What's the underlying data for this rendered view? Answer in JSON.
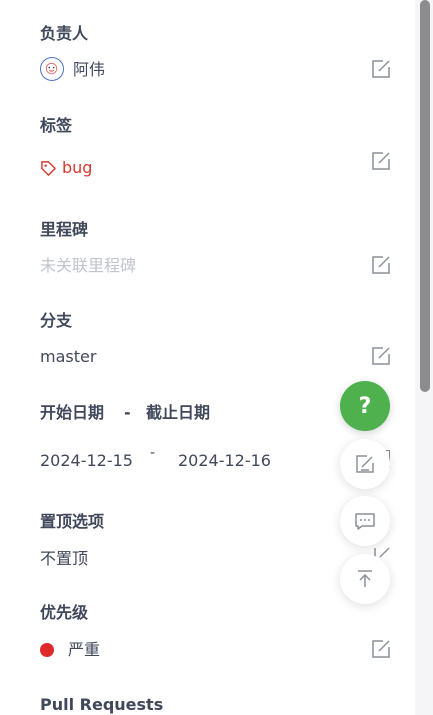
{
  "assignee": {
    "label": "负责人",
    "value": "阿伟"
  },
  "labels": {
    "label": "标签",
    "tag": "bug"
  },
  "milestone": {
    "label": "里程碑",
    "placeholder": "未关联里程碑"
  },
  "branch": {
    "label": "分支",
    "value": "master"
  },
  "dates": {
    "label_start": "开始日期",
    "separator": "-",
    "label_end": "截止日期",
    "start": "2024-12-15",
    "range_separator": "-",
    "end": "2024-12-16"
  },
  "pin": {
    "label": "置顶选项",
    "value": "不置顶"
  },
  "priority": {
    "label": "优先级",
    "value": "严重",
    "color": "#e0292b"
  },
  "pull_requests": {
    "label": "Pull Requests"
  },
  "floating": {
    "help_glyph": "?"
  },
  "colors": {
    "help_green": "#4eb14e",
    "tag_red": "#d33b31",
    "placeholder_gray": "#c0c4cc",
    "text": "#40485b"
  }
}
